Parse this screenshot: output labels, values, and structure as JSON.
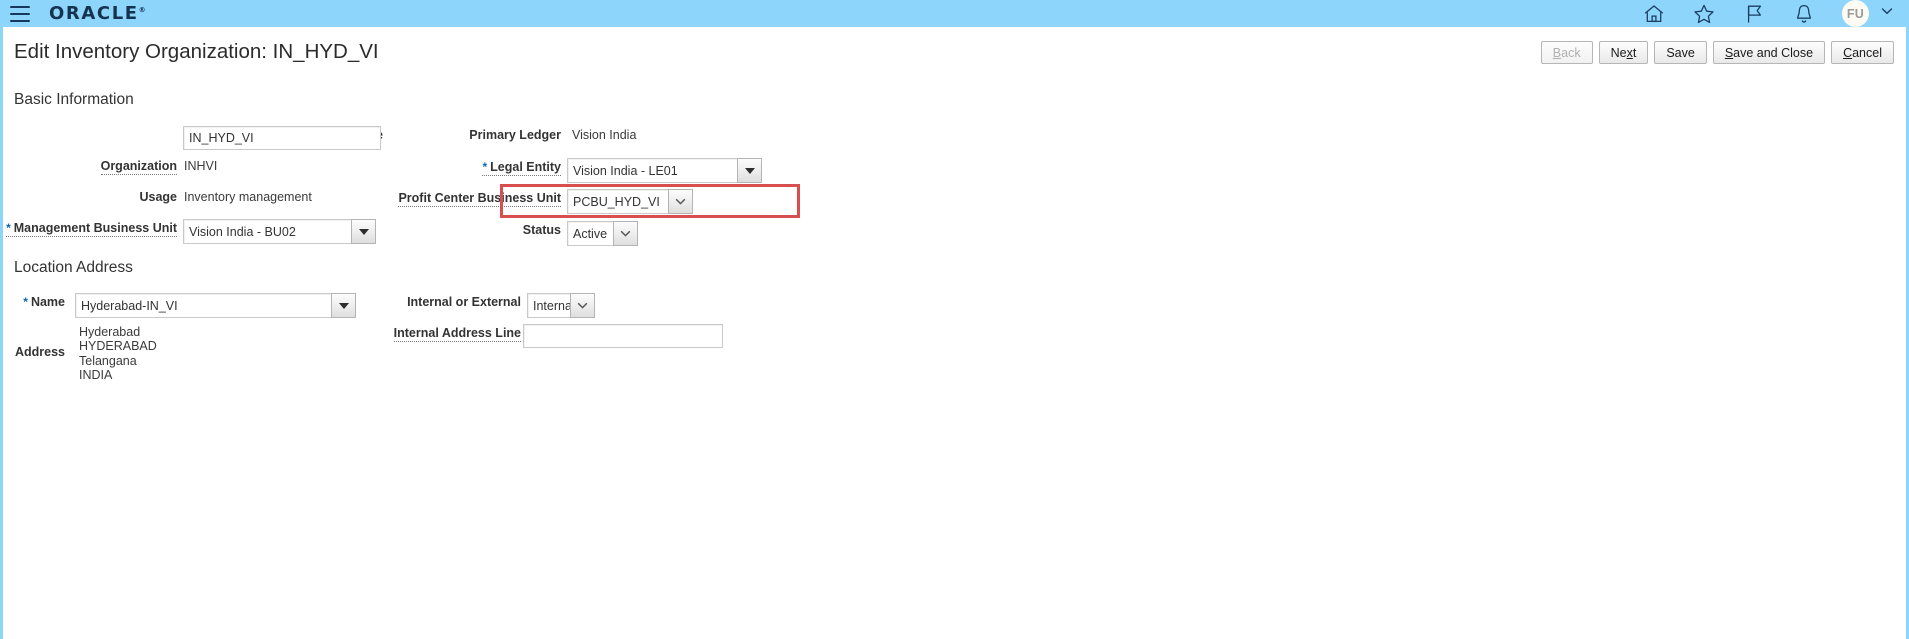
{
  "brand": {
    "logo_text": "ORACLE",
    "logo_mark": "®",
    "menu_icon": "hamburger-icon"
  },
  "topbar": {
    "icons": [
      {
        "name": "home-icon",
        "label": "Home"
      },
      {
        "name": "favorites-star-icon",
        "label": "Favorites"
      },
      {
        "name": "flag-icon",
        "label": "Watchlist"
      },
      {
        "name": "notifications-bell-icon",
        "label": "Notifications"
      }
    ],
    "avatar_initials": "FU",
    "avatar_chevron": "chevron-down-icon",
    "background_color": "#8ed5fb"
  },
  "header": {
    "title": "Edit Inventory Organization: IN_HYD_VI"
  },
  "actions": [
    {
      "label": "Back",
      "accesskey": "B",
      "disabled": true
    },
    {
      "label": "Next",
      "accesskey": "x",
      "disabled": false
    },
    {
      "label": "Save",
      "accesskey": "",
      "disabled": false
    },
    {
      "label": "Save and Close",
      "accesskey": "S",
      "disabled": false
    },
    {
      "label": "Cancel",
      "accesskey": "C",
      "disabled": false
    }
  ],
  "basic_information": {
    "heading": "Basic Information",
    "name": {
      "label": "Name",
      "value": "IN_HYD_VI",
      "required": true
    },
    "organization": {
      "label": "Organization",
      "value": "INHVI"
    },
    "usage": {
      "label": "Usage",
      "value": "Inventory management"
    },
    "management_business_unit": {
      "label": "Management Business Unit",
      "value": "Vision India - BU02",
      "required": true
    },
    "primary_ledger": {
      "label": "Primary Ledger",
      "value": "Vision India"
    },
    "legal_entity": {
      "label": "Legal Entity",
      "value": "Vision India - LE01",
      "required": true
    },
    "profit_center_business_unit": {
      "label": "Profit Center Business Unit",
      "value": "PCBU_HYD_VI",
      "highlighted": true
    },
    "status": {
      "label": "Status",
      "value": "Active"
    }
  },
  "location_address": {
    "heading": "Location Address",
    "name": {
      "label": "Name",
      "value": "Hyderabad-IN_VI",
      "required": true
    },
    "address": {
      "label": "Address",
      "lines": [
        "Hyderabad",
        "HYDERABAD",
        "Telangana",
        "INDIA"
      ]
    },
    "internal_or_external": {
      "label": "Internal or External",
      "value": "Internal"
    },
    "internal_address_line": {
      "label": "Internal Address Line",
      "value": "",
      "placeholder": ""
    }
  },
  "colors": {
    "brand_blue": "#8ed5fb",
    "highlight_red": "#d94f4f",
    "required_star": "#0a68b5"
  }
}
